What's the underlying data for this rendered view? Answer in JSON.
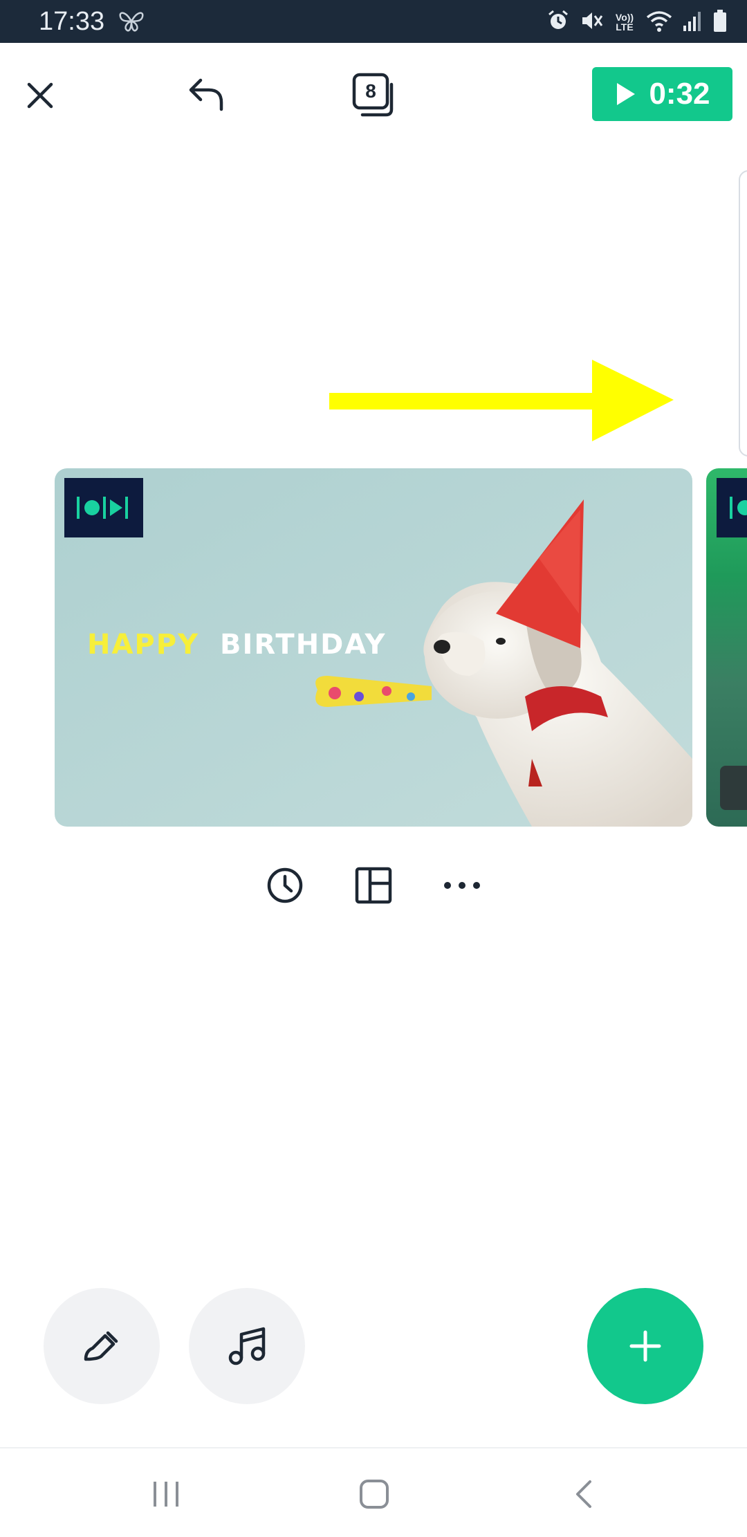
{
  "status_bar": {
    "time": "17:33",
    "icons": [
      "butterfly-icon",
      "alarm-icon",
      "mute-icon",
      "volte-icon",
      "wifi-icon",
      "signal-icon",
      "battery-icon"
    ],
    "volte_label": "Vo)) LTE"
  },
  "toolbar": {
    "close_icon": "close-icon",
    "undo_icon": "undo-icon",
    "slides_count": "8",
    "play_duration": "0:32"
  },
  "slide": {
    "happy_text": "HAPPY",
    "birthday_text": "BIRTHDAY"
  },
  "slide_actions": [
    "clock-icon",
    "layout-icon",
    "more-icon"
  ],
  "bottom_actions": [
    "brush-icon",
    "music-icon",
    "add-icon"
  ],
  "colors": {
    "accent": "#12c88c",
    "status_bar": "#1c2a3a",
    "arrow": "#ffff00",
    "slide_bg": "#b9d6d4"
  }
}
